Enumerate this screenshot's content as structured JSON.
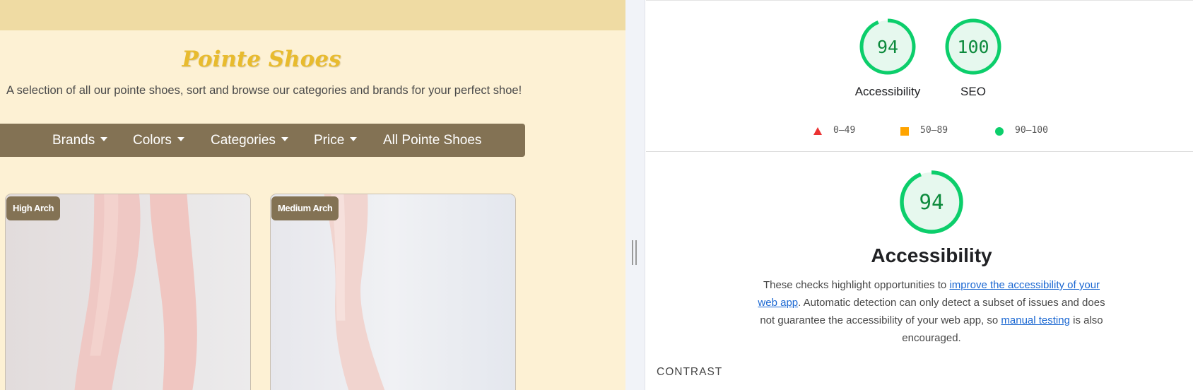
{
  "site": {
    "title": "Pointe Shoes",
    "subtitle": "A selection of all our pointe shoes, sort and browse our categories and brands for your perfect shoe!",
    "nav": {
      "brands": "Brands",
      "colors": "Colors",
      "categories": "Categories",
      "price": "Price",
      "all": "All Pointe Shoes"
    },
    "products": [
      {
        "badge": "High Arch"
      },
      {
        "badge": "Medium Arch"
      }
    ]
  },
  "lighthouse": {
    "scores": [
      {
        "label": "Accessibility",
        "score": "94",
        "value": 94
      },
      {
        "label": "SEO",
        "score": "100",
        "value": 100
      }
    ],
    "legend": {
      "fail": "0–49",
      "average": "50–89",
      "pass": "90–100"
    },
    "section": {
      "score": "94",
      "value": 94,
      "title": "Accessibility",
      "desc_1": "These checks highlight opportunities to ",
      "link_1": "improve the accessibility of your web app",
      "desc_2": ". Automatic detection can only detect a subset of issues and does not guarantee the accessibility of your web app, so ",
      "link_2": "manual testing",
      "desc_3": " is also encouraged."
    },
    "group_heading": "CONTRAST"
  },
  "colors": {
    "pass_green": "#0cce6b",
    "fail_red": "#eb3232",
    "average_orange": "#ffa400",
    "brand_brown": "#837254",
    "title_gold": "#e8bb2e"
  }
}
